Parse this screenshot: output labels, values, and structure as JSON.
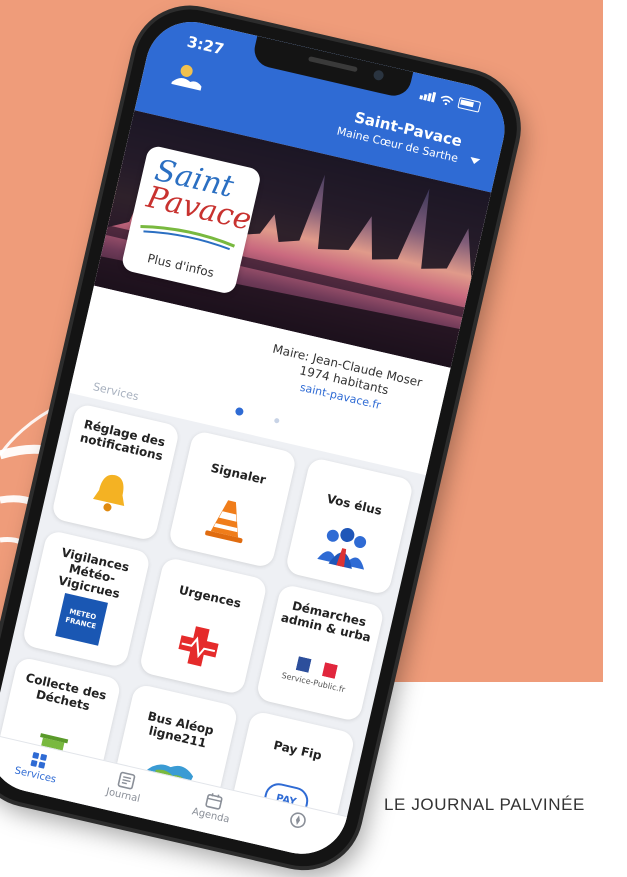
{
  "status": {
    "time": "3:27"
  },
  "header": {
    "town_name": "Saint-Pavace",
    "region": "Maine Cœur de Sarthe"
  },
  "town_card": {
    "logo_line1": "Saint",
    "logo_line2": "Pavace",
    "more_info": "Plus d'infos",
    "mayor": "Maire: Jean-Claude Moser",
    "population": "1974 habitants",
    "website": "saint-pavace.fr"
  },
  "services_label": "Services",
  "services": [
    {
      "label": "Réglage des notifications",
      "icon": "bell-icon"
    },
    {
      "label": "Signaler",
      "icon": "traffic-cone-icon"
    },
    {
      "label": "Vos élus",
      "icon": "people-icon"
    },
    {
      "label": "Vigilances Météo-Vigicrues",
      "icon": "meteo-france-icon",
      "icon_text": "METEO FRANCE"
    },
    {
      "label": "Urgences",
      "icon": "red-cross-icon"
    },
    {
      "label": "Démarches admin & urba",
      "icon": "service-public-icon",
      "icon_text": "Service-Public.fr"
    },
    {
      "label": "Collecte des Déchets",
      "icon": "recycle-bin-icon"
    },
    {
      "label": "Bus Aléop ligne211",
      "icon": "map-icon"
    },
    {
      "label": "Pay Fip",
      "icon": "payfip-icon",
      "icon_text": "PAY"
    }
  ],
  "tabs": [
    {
      "label": "Services",
      "icon": "services-icon",
      "active": true
    },
    {
      "label": "Journal",
      "icon": "journal-icon",
      "active": false
    },
    {
      "label": "Agenda",
      "icon": "agenda-icon",
      "active": false
    },
    {
      "label": "",
      "icon": "compass-icon",
      "active": false
    }
  ],
  "footer": {
    "text": "LE JOURNAL PALVINÉE"
  },
  "colors": {
    "background": "#ef9c7a",
    "accent": "#2f6bd4",
    "frame": "#141414"
  }
}
